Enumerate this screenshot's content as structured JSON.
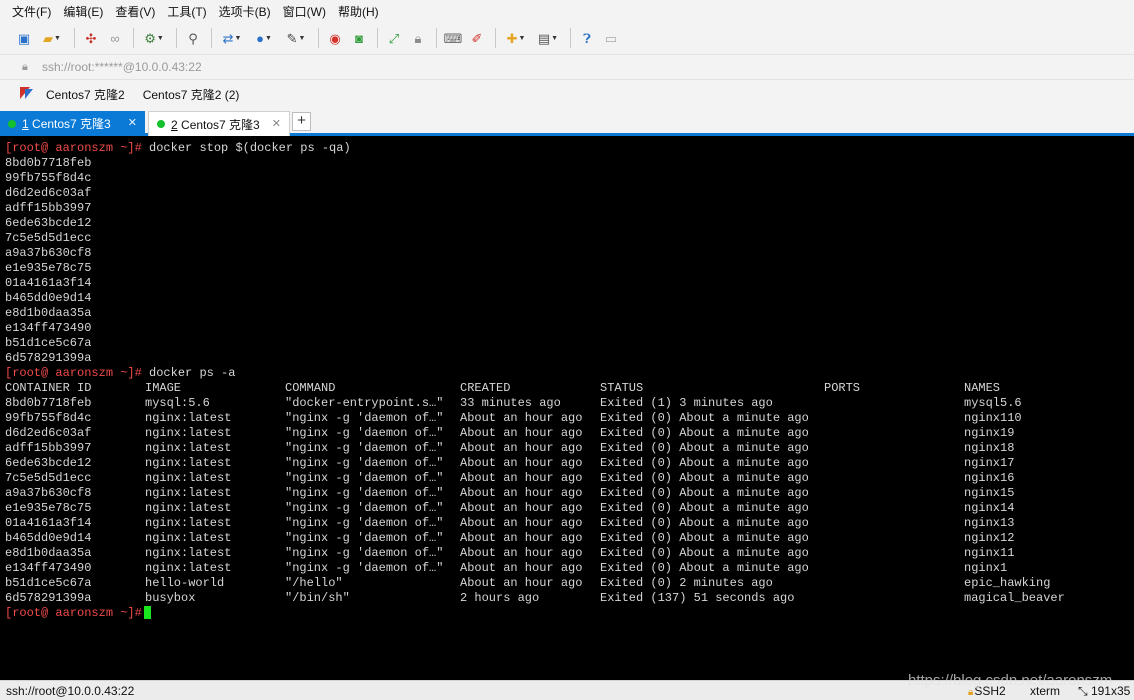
{
  "menu": [
    "文件(F)",
    "编辑(E)",
    "查看(V)",
    "工具(T)",
    "选项卡(B)",
    "窗口(W)",
    "帮助(H)"
  ],
  "address": "ssh://root:******@10.0.0.43:22",
  "links": [
    "Centos7 克隆2",
    "Centos7 克隆2 (2)"
  ],
  "tabs": [
    {
      "num": "1",
      "label": " Centos7 克隆3"
    },
    {
      "num": "2",
      "label": " Centos7 克隆3"
    }
  ],
  "tab_close": "✕",
  "new_tab": "+",
  "terminal": {
    "prompt": "[root@ aaronszm ~]#",
    "cmd1": " docker stop $(docker ps -qa)",
    "stopped_ids": [
      "8bd0b7718feb",
      "99fb755f8d4c",
      "d6d2ed6c03af",
      "adff15bb3997",
      "6ede63bcde12",
      "7c5e5d5d1ecc",
      "a9a37b630cf8",
      "e1e935e78c75",
      "01a4161a3f14",
      "b465dd0e9d14",
      "e8d1b0daa35a",
      "e134ff473490",
      "b51d1ce5c67a",
      "6d578291399a"
    ],
    "cmd2": " docker ps -a",
    "headers": [
      "CONTAINER ID",
      "IMAGE",
      "COMMAND",
      "CREATED",
      "STATUS",
      "PORTS",
      "NAMES"
    ],
    "rows": [
      [
        "8bd0b7718feb",
        "mysql:5.6",
        "\"docker-entrypoint.s…\"",
        "33 minutes ago",
        "Exited (1) 3 minutes ago",
        "",
        "mysql5.6"
      ],
      [
        "99fb755f8d4c",
        "nginx:latest",
        "\"nginx -g 'daemon of…\"",
        "About an hour ago",
        "Exited (0) About a minute ago",
        "",
        "nginx110"
      ],
      [
        "d6d2ed6c03af",
        "nginx:latest",
        "\"nginx -g 'daemon of…\"",
        "About an hour ago",
        "Exited (0) About a minute ago",
        "",
        "nginx19"
      ],
      [
        "adff15bb3997",
        "nginx:latest",
        "\"nginx -g 'daemon of…\"",
        "About an hour ago",
        "Exited (0) About a minute ago",
        "",
        "nginx18"
      ],
      [
        "6ede63bcde12",
        "nginx:latest",
        "\"nginx -g 'daemon of…\"",
        "About an hour ago",
        "Exited (0) About a minute ago",
        "",
        "nginx17"
      ],
      [
        "7c5e5d5d1ecc",
        "nginx:latest",
        "\"nginx -g 'daemon of…\"",
        "About an hour ago",
        "Exited (0) About a minute ago",
        "",
        "nginx16"
      ],
      [
        "a9a37b630cf8",
        "nginx:latest",
        "\"nginx -g 'daemon of…\"",
        "About an hour ago",
        "Exited (0) About a minute ago",
        "",
        "nginx15"
      ],
      [
        "e1e935e78c75",
        "nginx:latest",
        "\"nginx -g 'daemon of…\"",
        "About an hour ago",
        "Exited (0) About a minute ago",
        "",
        "nginx14"
      ],
      [
        "01a4161a3f14",
        "nginx:latest",
        "\"nginx -g 'daemon of…\"",
        "About an hour ago",
        "Exited (0) About a minute ago",
        "",
        "nginx13"
      ],
      [
        "b465dd0e9d14",
        "nginx:latest",
        "\"nginx -g 'daemon of…\"",
        "About an hour ago",
        "Exited (0) About a minute ago",
        "",
        "nginx12"
      ],
      [
        "e8d1b0daa35a",
        "nginx:latest",
        "\"nginx -g 'daemon of…\"",
        "About an hour ago",
        "Exited (0) About a minute ago",
        "",
        "nginx11"
      ],
      [
        "e134ff473490",
        "nginx:latest",
        "\"nginx -g 'daemon of…\"",
        "About an hour ago",
        "Exited (0) About a minute ago",
        "",
        "nginx1"
      ],
      [
        "b51d1ce5c67a",
        "hello-world",
        "\"/hello\"",
        "About an hour ago",
        "Exited (0) 2 minutes ago",
        "",
        "epic_hawking"
      ],
      [
        "6d578291399a",
        "busybox",
        "\"/bin/sh\"",
        "2 hours ago",
        "Exited (137) 51 seconds ago",
        "",
        "magical_beaver"
      ]
    ]
  },
  "status": {
    "connection": "ssh://root@10.0.0.43:22",
    "protocol": "SSH2",
    "term": "xterm",
    "size": "191x35"
  },
  "watermark": "https://blog.csdn.net/aaronszm",
  "colors": {
    "accent": "#0a7ad6",
    "prompt": "#f04a4a",
    "cursor": "#19e61c",
    "connected_dot": "#15c02d"
  }
}
